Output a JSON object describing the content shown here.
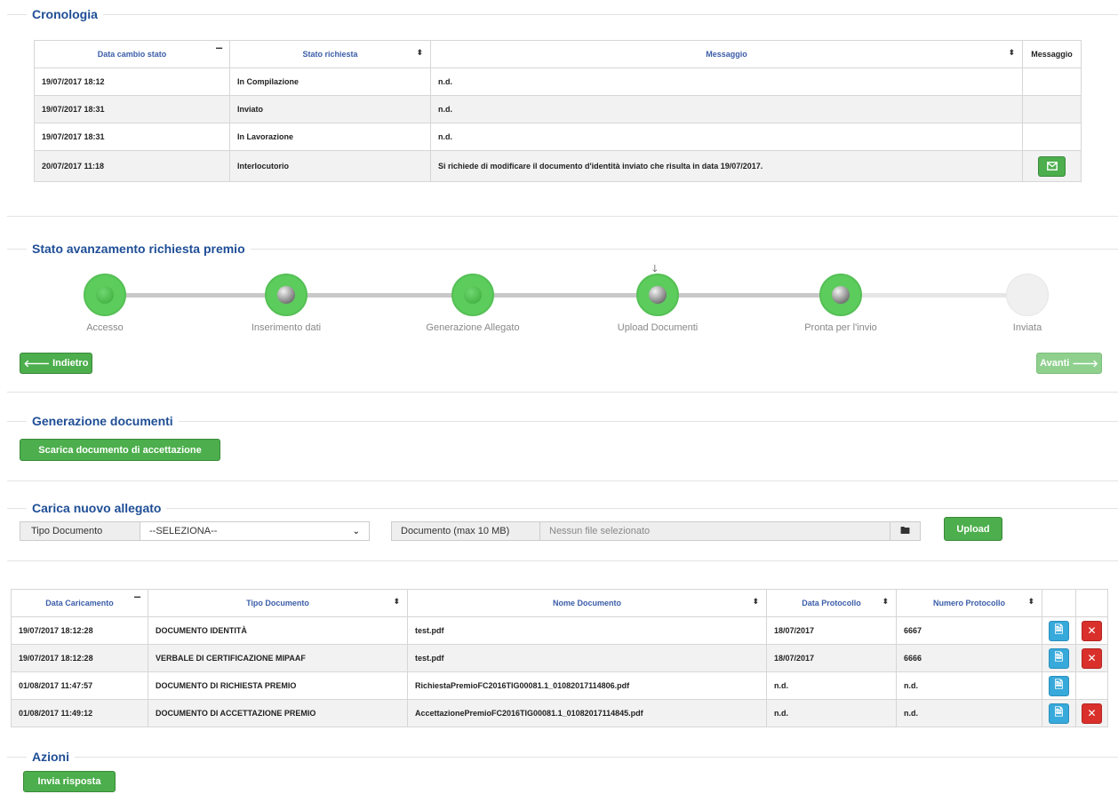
{
  "cronologia": {
    "legend": "Cronologia",
    "headers": [
      "Data cambio stato",
      "Stato richiesta",
      "Messaggio",
      "Messaggio"
    ],
    "rows": [
      {
        "date": "19/07/2017 18:12",
        "stato": "In Compilazione",
        "messaggio": "n.d."
      },
      {
        "date": "19/07/2017 18:31",
        "stato": "Inviato",
        "messaggio": "n.d."
      },
      {
        "date": "19/07/2017 18:31",
        "stato": "In Lavorazione",
        "messaggio": "n.d."
      },
      {
        "date": "20/07/2017 11:18",
        "stato": "Interlocutorio",
        "messaggio": "Si richiede di modificare il documento d'identità inviato che risulta in data 19/07/2017."
      }
    ]
  },
  "avanzamento": {
    "legend": "Stato avanzamento richiesta premio",
    "steps": [
      {
        "label": "Accesso",
        "state": "done"
      },
      {
        "label": "Inserimento dati",
        "state": "done"
      },
      {
        "label": "Generazione Allegato",
        "state": "done"
      },
      {
        "label": "Upload Documenti",
        "state": "current"
      },
      {
        "label": "Pronta per l'invio",
        "state": "done"
      },
      {
        "label": "Inviata",
        "state": "todo"
      }
    ],
    "back_label": "Indietro",
    "next_label": "Avanti"
  },
  "generazione": {
    "legend": "Generazione documenti",
    "button_label": "Scarica documento di accettazione"
  },
  "carica": {
    "legend": "Carica nuovo allegato",
    "tipo_label": "Tipo Documento",
    "tipo_value": "--SELEZIONA--",
    "documento_label": "Documento (max 10 MB)",
    "documento_placeholder": "Nessun file selezionato",
    "upload_label": "Upload"
  },
  "allegati": {
    "headers": [
      "Data Caricamento",
      "Tipo Documento",
      "Nome Documento",
      "Data Protocollo",
      "Numero Protocollo"
    ],
    "rows": [
      {
        "date": "19/07/2017 18:12:28",
        "tipo": "DOCUMENTO IDENTITÀ",
        "nome": "test.pdf",
        "data_prot": "18/07/2017",
        "num_prot": "6667",
        "deletable": true
      },
      {
        "date": "19/07/2017 18:12:28",
        "tipo": "VERBALE DI CERTIFICAZIONE MIPAAF",
        "nome": "test.pdf",
        "data_prot": "18/07/2017",
        "num_prot": "6666",
        "deletable": true
      },
      {
        "date": "01/08/2017 11:47:57",
        "tipo": "DOCUMENTO DI RICHIESTA PREMIO",
        "nome": "RichiestaPremioFC2016TIG00081.1_01082017114806.pdf",
        "data_prot": "n.d.",
        "num_prot": "n.d.",
        "deletable": false
      },
      {
        "date": "01/08/2017 11:49:12",
        "tipo": "DOCUMENTO DI ACCETTAZIONE PREMIO",
        "nome": "AccettazionePremioFC2016TIG00081.1_01082017114845.pdf",
        "data_prot": "n.d.",
        "num_prot": "n.d.",
        "deletable": true
      }
    ]
  },
  "azioni": {
    "legend": "Azioni",
    "button_label": "Invia risposta"
  },
  "colors": {
    "legend": "#1f4e96",
    "header_link": "#3b5da8",
    "primary_green": "#4cae4c",
    "info_blue": "#37a9db",
    "danger_red": "#d9302c"
  }
}
